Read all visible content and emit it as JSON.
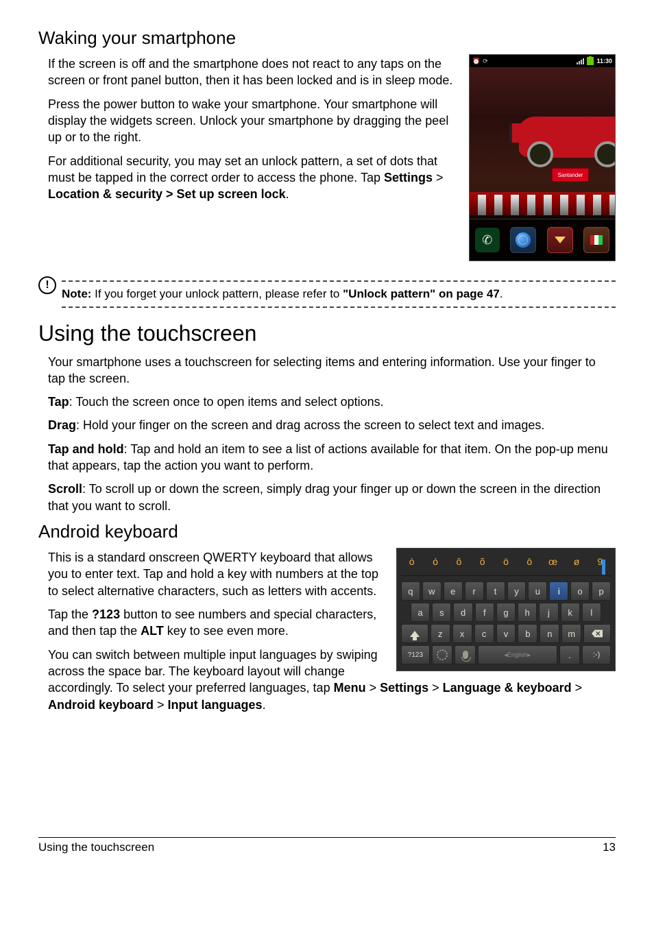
{
  "section1": {
    "heading": "Waking your smartphone",
    "p1": "If the screen is off and the smartphone does not react to any taps on the screen or front panel button, then it has been locked and is in sleep mode.",
    "p2": "Press the power button to wake your smartphone. Your smartphone will display the widgets screen. Unlock your smartphone by dragging the peel up or to the right.",
    "p3_pre": "For additional security, you may set an unlock pattern, a set of dots that must be tapped in the correct order to access the phone. Tap ",
    "p3_b1": "Settings",
    "p3_mid": " > ",
    "p3_b2": "Location & security > Set up screen lock",
    "p3_post": "."
  },
  "lockscreen": {
    "time": "11:30",
    "banner": "Santander"
  },
  "note": {
    "label": "Note:",
    "text": " If you forget your unlock pattern, please refer to ",
    "ref": "\"Unlock pattern\" on page 47",
    "post": "."
  },
  "section2": {
    "heading": "Using the touchscreen",
    "p1": "Your smartphone uses a touchscreen for selecting items and entering information. Use your finger to tap the screen.",
    "tap_b": "Tap",
    "tap_t": ": Touch the screen once to open items and select options.",
    "drag_b": "Drag",
    "drag_t": ": Hold your finger on the screen and drag across the screen to select text and images.",
    "th_b": "Tap and hold",
    "th_t": ": Tap and hold an item to see a list of actions available for that item. On the pop-up menu that appears, tap the action you want to perform.",
    "sc_b": "Scroll",
    "sc_t": ": To scroll up or down the screen, simply drag your finger up or down the screen in the direction that you want to scroll."
  },
  "section3": {
    "heading": "Android keyboard",
    "p1": "This is a standard onscreen QWERTY keyboard that allows you to enter text. Tap and hold a key with numbers at the top to select alternative characters, such as letters with accents.",
    "p2_pre": "Tap the ",
    "p2_b1": "?123",
    "p2_mid": " button to see numbers and special characters, and then tap the ",
    "p2_b2": "ALT",
    "p2_post": " key to see even more.",
    "p3_pre": "You can switch between multiple input languages by swiping across the space bar. The keyboard layout will change accordingly. To select your preferred languages, tap ",
    "p3_b1": "Menu",
    "p3_s1": " > ",
    "p3_b2": "Settings",
    "p3_s2": " > ",
    "p3_b3": "Language & keyboard",
    "p3_s3": " > ",
    "p3_b4": "Android keyboard",
    "p3_s4": " > ",
    "p3_b5": "Input languages",
    "p3_post": "."
  },
  "keyboard": {
    "alt_row": [
      "ò",
      "ó",
      "ô",
      "õ",
      "ö",
      "ō",
      "œ",
      "ø",
      "9"
    ],
    "row1": [
      "q",
      "w",
      "e",
      "r",
      "t",
      "y",
      "u",
      "i",
      "o",
      "p"
    ],
    "row2": [
      "a",
      "s",
      "d",
      "f",
      "g",
      "h",
      "j",
      "k",
      "l"
    ],
    "row3_mid": [
      "z",
      "x",
      "c",
      "v",
      "b",
      "n",
      "m"
    ],
    "sym_key": "?123",
    "space": "English",
    "period": ".",
    "smile": ":-)"
  },
  "footer": {
    "left": "Using the touchscreen",
    "right": "13"
  }
}
